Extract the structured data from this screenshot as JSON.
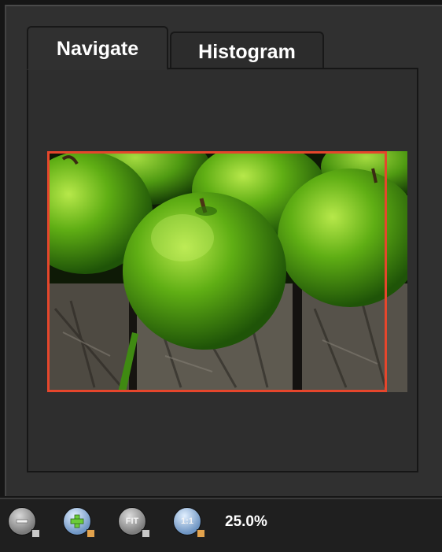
{
  "tabs": [
    {
      "label": "Navigate",
      "active": true
    },
    {
      "label": "Histogram",
      "active": false
    }
  ],
  "navigator": {
    "preview_subject": "green apples on wooden boards",
    "viewport_border_color": "#e6462c"
  },
  "toolbar": {
    "zoom_out_icon": "zoom-out-icon",
    "zoom_in_icon": "zoom-in-icon",
    "fit_label": "FIT",
    "actual_size_label": "1:1",
    "zoom_level": "25.0%"
  }
}
